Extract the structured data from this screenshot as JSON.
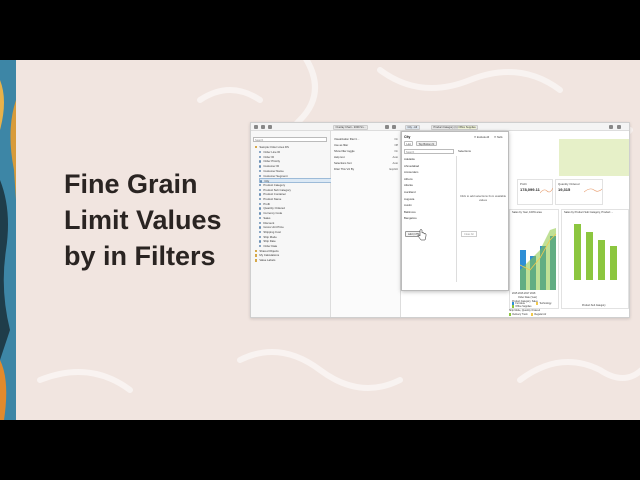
{
  "headline": {
    "line1": "Fine Grain",
    "line2": "Limit Values",
    "line3": "by in Filters"
  },
  "app": {
    "canvas_tab": "Overlay Chart - 2009 Sn...",
    "filter_chip_city": "City - All",
    "filter_chip_category": "Product Category (1)",
    "filter_chip_category_value": "Office Supplies",
    "data_panel": {
      "search_placeholder": "Search",
      "root": "Sample Order Lines DS",
      "items": [
        "Order Line ID",
        "Order ID",
        "Order Priority",
        "Customer ID",
        "Customer Name",
        "Customer Segment",
        "City",
        "Product Category",
        "Product Sub Category",
        "Product Container",
        "Product Name",
        "Profit",
        "Quantity Ordered",
        "Currency Code",
        "Sales",
        "Discount",
        "Gross Unit Price",
        "Shipping Cost",
        "Ship Mode",
        "Ship Date",
        "Order Date",
        "Shared Objects",
        "My Calculations",
        "Value Labels"
      ]
    },
    "properties": [
      {
        "label": "Visualization filter b...",
        "value": "On"
      },
      {
        "label": "Use as filter",
        "value": "Off"
      },
      {
        "label": "Show filter toggle",
        "value": "On"
      },
      {
        "label": "Help text",
        "value": "Auto"
      },
      {
        "label": "Selections font",
        "value": "Auto"
      },
      {
        "label": "Filter This Viz By",
        "value": "Explicit"
      }
    ],
    "popup": {
      "title": "City",
      "list_button": "List",
      "top_bottom_button": "Top Bottom N",
      "search_placeholder": "Search",
      "exclude_label": "Exclude All",
      "nulls_label": "Nulls",
      "selections_label": "Selections",
      "values": [
        "Adelaide",
        "Ahmedabad",
        "Amsterdam",
        "Athens",
        "Atlanta",
        "Auckland",
        "Augusta",
        "Austin",
        "Baltimore",
        "Bangalore"
      ],
      "hint": "Click to add selections from available values",
      "limit_button": "Add (175)",
      "clear_button": "Clear All"
    },
    "kpis": [
      {
        "label": "Profit",
        "value": "178,099.11"
      },
      {
        "label": "Quantity Ordered",
        "value": "19,315"
      }
    ],
    "charts": {
      "left_title": "Sales by Year, 100% area",
      "right_title": "Sales by Product Sub Category, Product ...",
      "left_xlabel": "Order Date (Year)",
      "right_xlabel": "Product Sub Category",
      "left_legend_title": "Product Category, Sales",
      "legend": [
        "Furniture",
        "Technology",
        "Office Supplies"
      ],
      "ship_legend_title": "Ship Mode, Quantity Ordered",
      "ship_legend": [
        "Delivery Truck",
        "Regular Air"
      ],
      "years": [
        "2015",
        "2016",
        "2017",
        "2018"
      ]
    },
    "colors": {
      "accent_blue": "#2f8fd6",
      "accent_green": "#8cc63f",
      "filter_green": "#e6f0c8"
    }
  }
}
